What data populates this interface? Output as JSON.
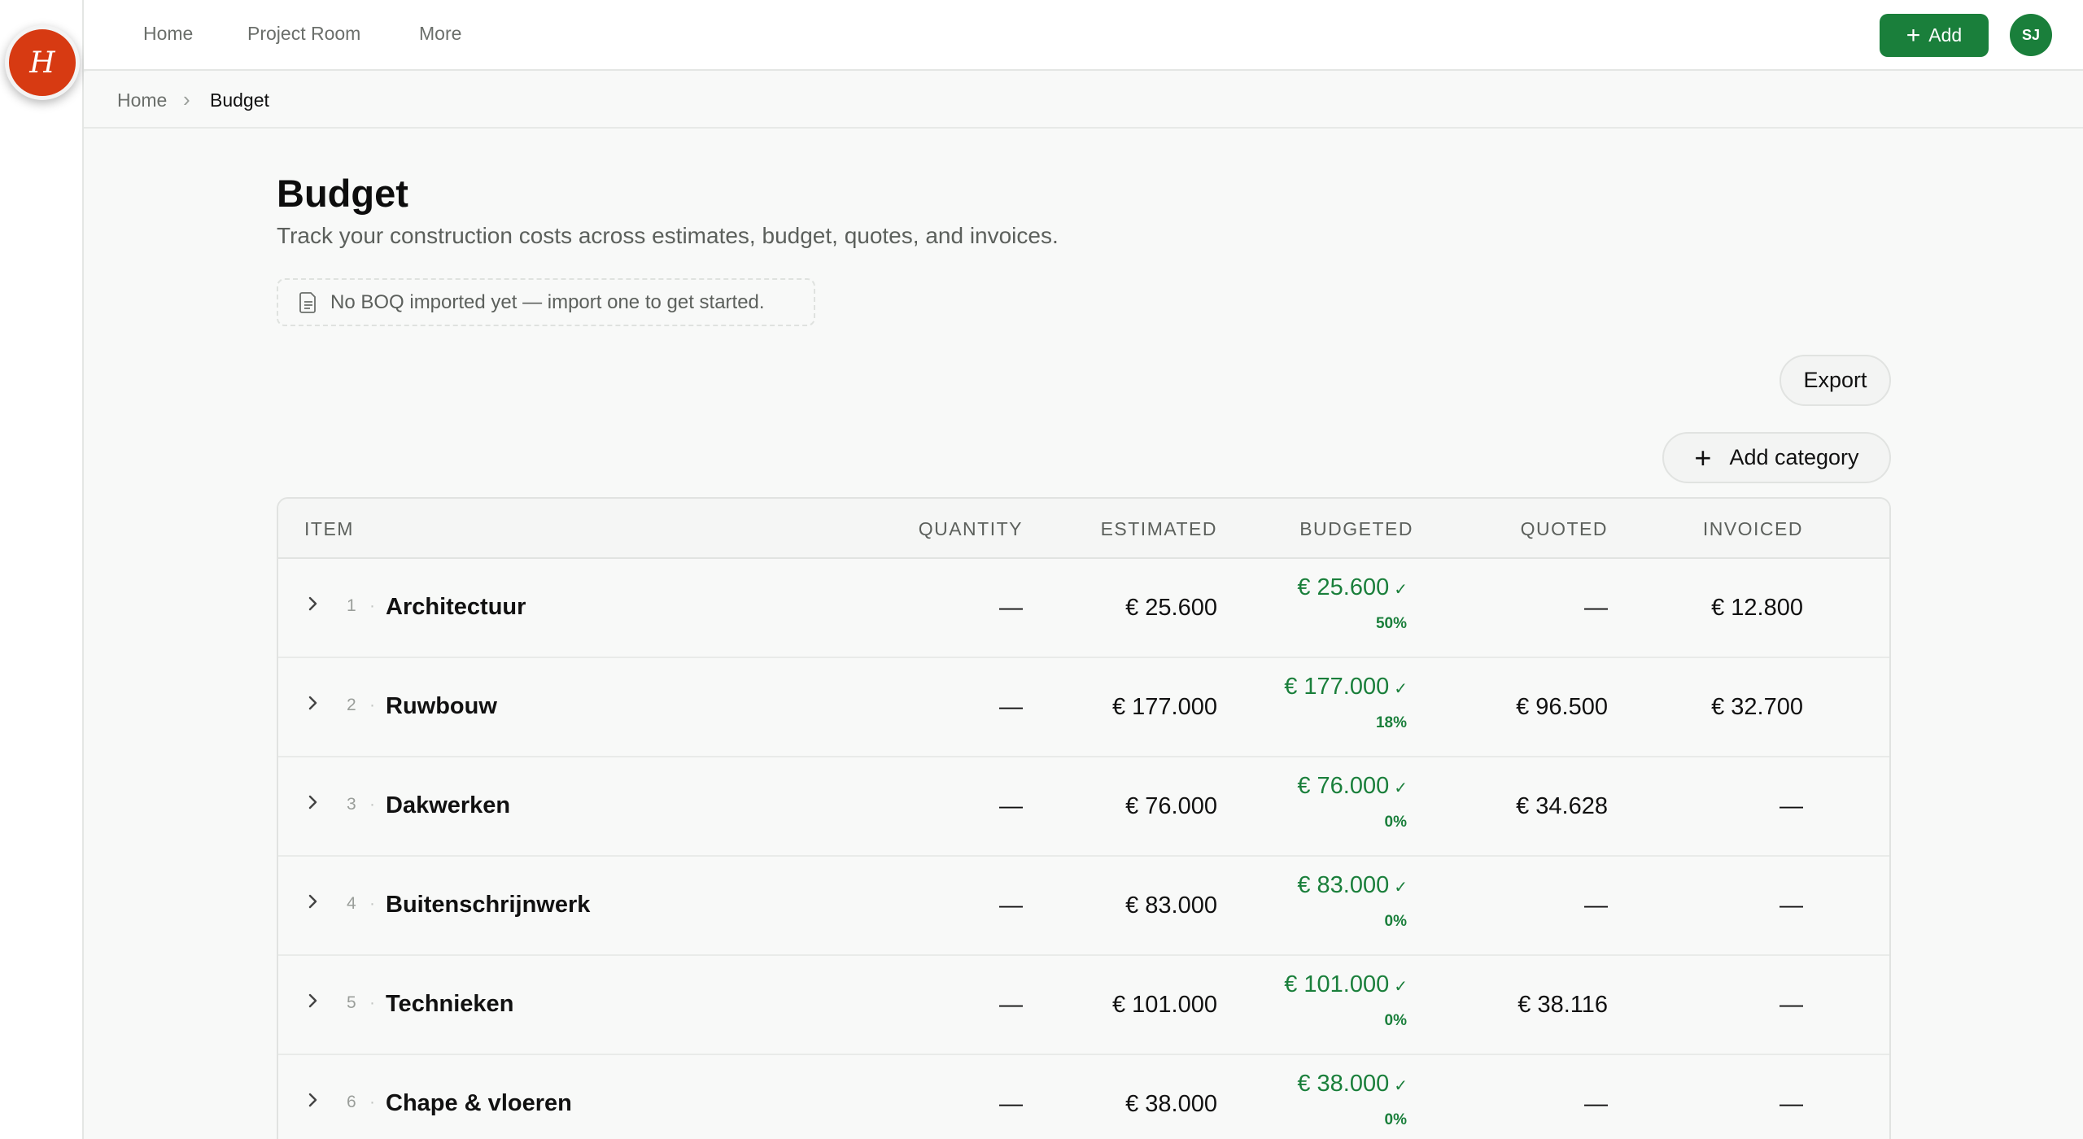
{
  "app": {
    "logo_letter": "H"
  },
  "topnav": {
    "items": [
      "Home",
      "Project Room",
      "More"
    ],
    "add_label": "Add",
    "avatar_initials": "SJ"
  },
  "breadcrumb": {
    "home": "Home",
    "current": "Budget"
  },
  "page": {
    "title": "Budget",
    "subtitle": "Track your construction costs across estimates, budget, quotes, and invoices.",
    "boq_note": "No BOQ imported yet — import one to get started.",
    "export_label": "Export",
    "add_category_label": "Add category"
  },
  "table": {
    "headers": [
      "ITEM",
      "QUANTITY",
      "ESTIMATED",
      "BUDGETED",
      "QUOTED",
      "INVOICED"
    ],
    "rows": [
      {
        "index": "1",
        "name": "Architectuur",
        "quantity": "—",
        "estimated": "€ 25.600",
        "budgeted": "€ 25.600",
        "pct": "50%",
        "quoted": "—",
        "invoiced": "€ 12.800"
      },
      {
        "index": "2",
        "name": "Ruwbouw",
        "quantity": "—",
        "estimated": "€ 177.000",
        "budgeted": "€ 177.000",
        "pct": "18%",
        "quoted": "€ 96.500",
        "invoiced": "€ 32.700"
      },
      {
        "index": "3",
        "name": "Dakwerken",
        "quantity": "—",
        "estimated": "€ 76.000",
        "budgeted": "€ 76.000",
        "pct": "0%",
        "quoted": "€ 34.628",
        "invoiced": "—"
      },
      {
        "index": "4",
        "name": "Buitenschrijnwerk",
        "quantity": "—",
        "estimated": "€ 83.000",
        "budgeted": "€ 83.000",
        "pct": "0%",
        "quoted": "—",
        "invoiced": "—"
      },
      {
        "index": "5",
        "name": "Technieken",
        "quantity": "—",
        "estimated": "€ 101.000",
        "budgeted": "€ 101.000",
        "pct": "0%",
        "quoted": "€ 38.116",
        "invoiced": "—"
      },
      {
        "index": "6",
        "name": "Chape & vloeren",
        "quantity": "—",
        "estimated": "€ 38.000",
        "budgeted": "€ 38.000",
        "pct": "0%",
        "quoted": "—",
        "invoiced": "—"
      }
    ]
  },
  "colors": {
    "accent": "#1a7f3b",
    "logo": "#d73a12"
  }
}
